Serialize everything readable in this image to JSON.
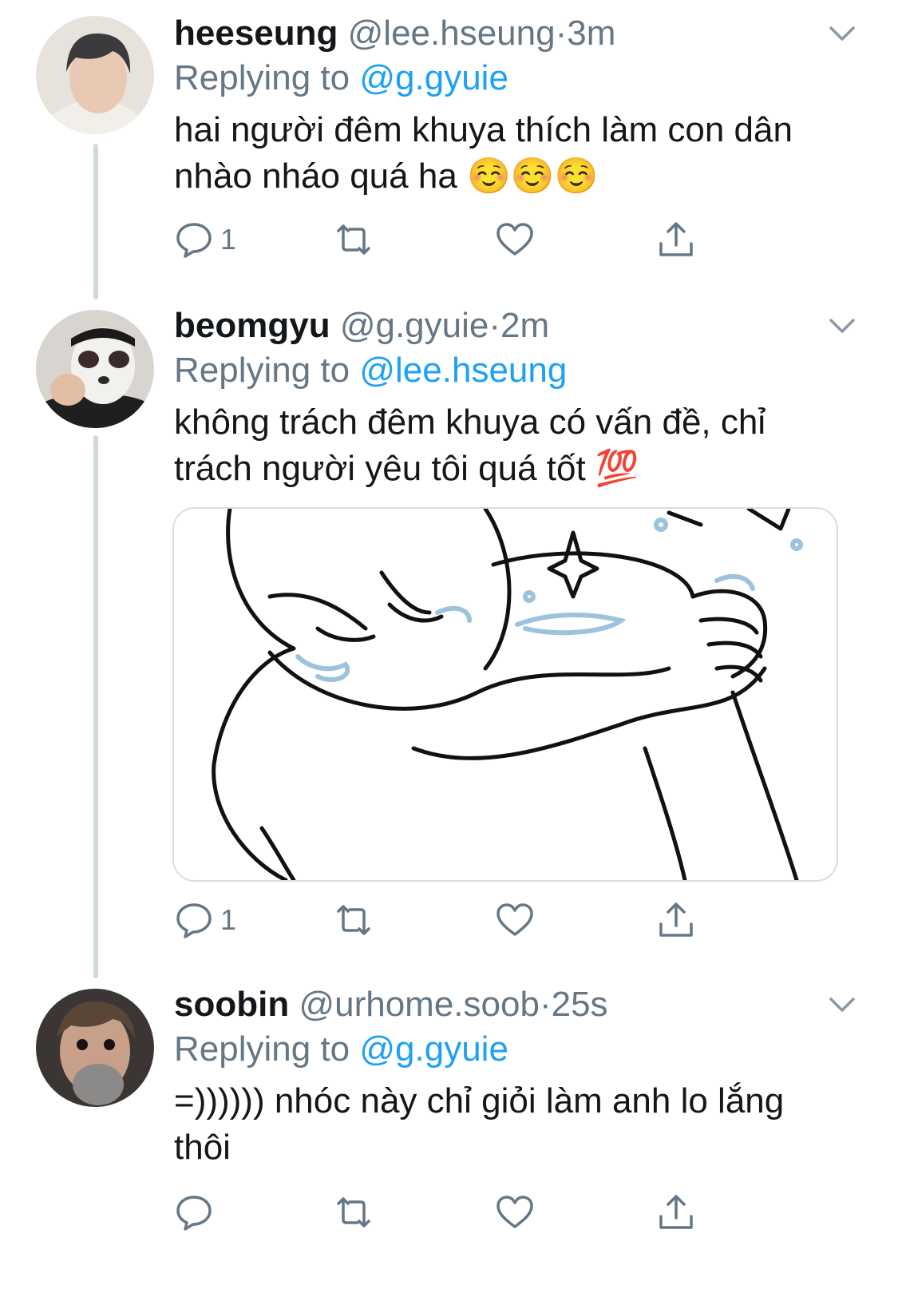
{
  "tweets": [
    {
      "name": "heeseung",
      "handle": "@lee.hseung",
      "dot": "·",
      "time": "3m",
      "replying_prefix": "Replying to ",
      "replying_to": "@g.gyuie",
      "text": "hai người đêm khuya thích làm con dân nhào nháo quá ha ☺️☺️☺️",
      "reply_count": "1",
      "avatar_icon": "person-avatar"
    },
    {
      "name": "beomgyu",
      "handle": "@g.gyuie",
      "dot": "·",
      "time": "2m",
      "replying_prefix": "Replying to ",
      "replying_to": "@lee.hseung",
      "text": "không trách đêm khuya có vấn đề, chỉ trách người yêu tôi quá tốt 💯",
      "reply_count": "1",
      "avatar_icon": "panda-mask-avatar"
    },
    {
      "name": "soobin",
      "handle": "@urhome.soob",
      "dot": "·",
      "time": "25s",
      "replying_prefix": "Replying to ",
      "replying_to": "@g.gyuie",
      "text": "=)))))) nhóc này chỉ giỏi làm anh lo lắng thôi",
      "reply_count": "",
      "avatar_icon": "person-avatar"
    }
  ],
  "icons": [
    "reply-icon",
    "retweet-icon",
    "like-icon",
    "share-icon",
    "chevron-down-icon"
  ],
  "colors": {
    "link": "#1da1f2",
    "secondary": "#657786",
    "primary_text": "#14171a",
    "thread_line": "#cfd9de"
  }
}
